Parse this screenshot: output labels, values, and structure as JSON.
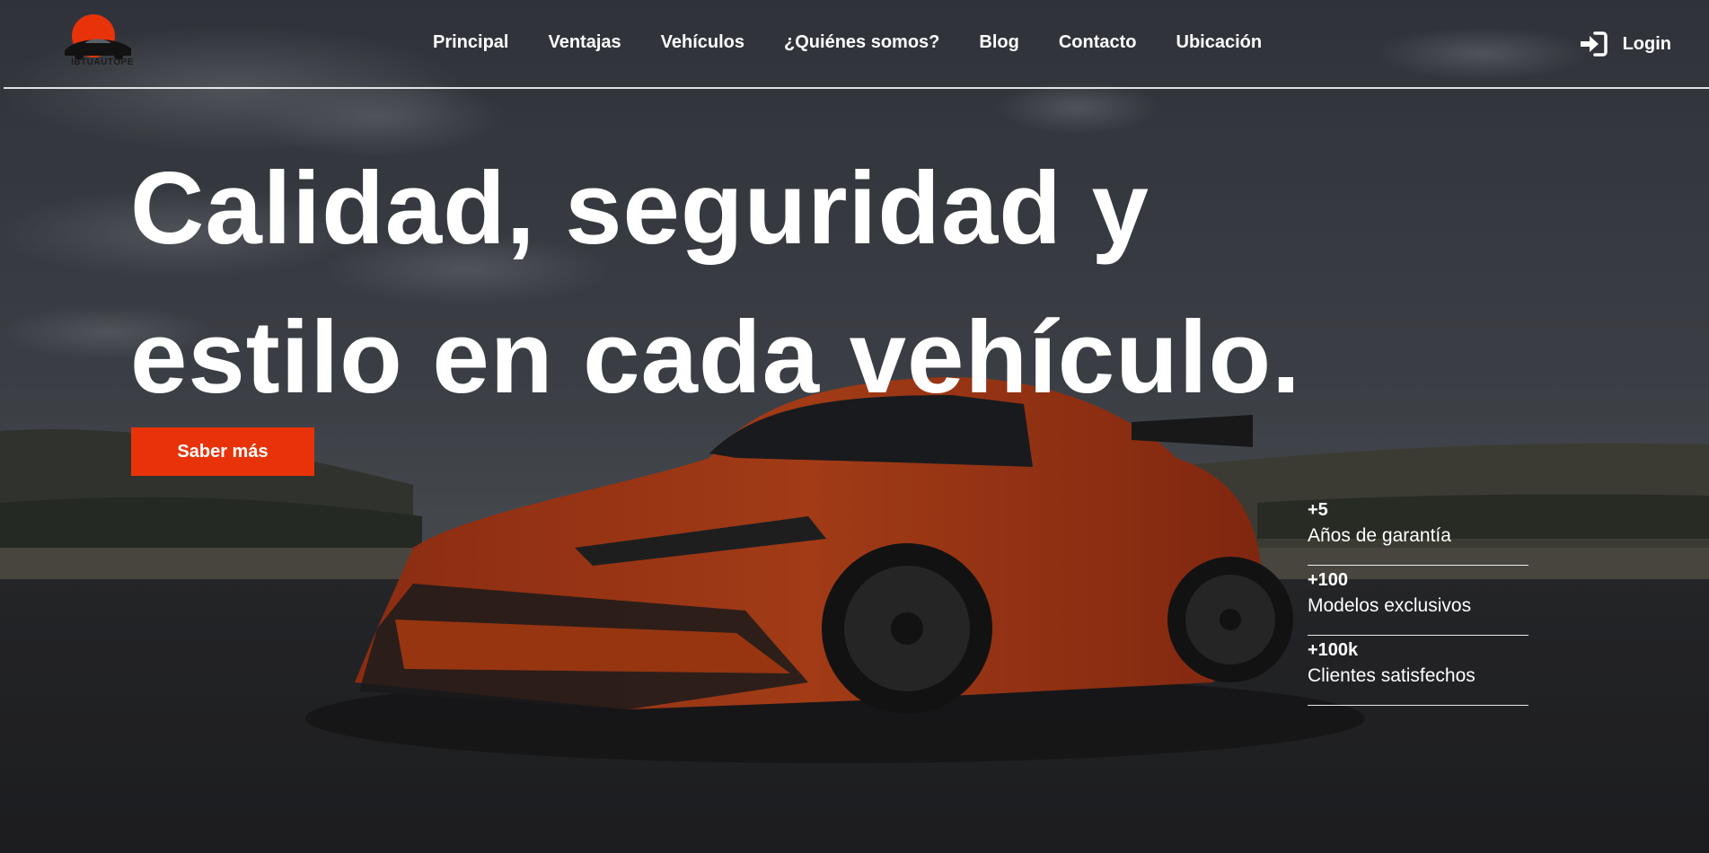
{
  "brand": {
    "name": "IBTUAUTOPE"
  },
  "nav": {
    "items": [
      {
        "label": "Principal"
      },
      {
        "label": "Ventajas"
      },
      {
        "label": "Vehículos"
      },
      {
        "label": "¿Quiénes somos?"
      },
      {
        "label": "Blog"
      },
      {
        "label": "Contacto"
      },
      {
        "label": "Ubicación"
      }
    ],
    "login_label": "Login"
  },
  "hero": {
    "headline_line1": "Calidad, seguridad y",
    "headline_line2": "estilo en cada vehículo.",
    "cta_label": "Saber más"
  },
  "stats": [
    {
      "value": "+5",
      "label": "Años de garantía"
    },
    {
      "value": "+100",
      "label": "Modelos exclusivos"
    },
    {
      "value": "+100k",
      "label": "Clientes satisfechos"
    }
  ],
  "colors": {
    "accent": "#e8330a",
    "text": "#ffffff"
  },
  "icons": {
    "login": "login-arrow-icon",
    "logo": "car-sunset-logo-icon"
  }
}
